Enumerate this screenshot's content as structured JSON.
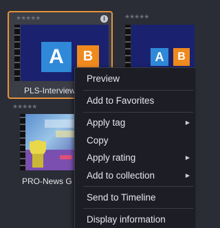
{
  "tiles": [
    {
      "label": "PLS-Interview",
      "block_a": "A",
      "block_b": "B",
      "stars": "★★★★★",
      "info": "i"
    },
    {
      "label": "",
      "block_a": "A",
      "block_b": "B",
      "stars": "★★★★★"
    },
    {
      "label": "PRO-News G",
      "stars": "★★★★★"
    }
  ],
  "menu": {
    "items": [
      {
        "label": "Preview"
      },
      {
        "label": "Add to Favorites"
      },
      {
        "label": "Apply tag",
        "submenu": true
      },
      {
        "label": "Copy"
      },
      {
        "label": "Apply rating",
        "submenu": true
      },
      {
        "label": "Add to collection",
        "submenu": true
      },
      {
        "label": "Send to Timeline"
      },
      {
        "label": "Display information"
      }
    ],
    "submenu_arrow": "▶"
  },
  "colors": {
    "background": "#2b2d36",
    "selected_border": "#e8933a",
    "menu_bg": "#1d1e25",
    "blue_block": "#2f89d8",
    "orange_block": "#ef8a1e"
  }
}
